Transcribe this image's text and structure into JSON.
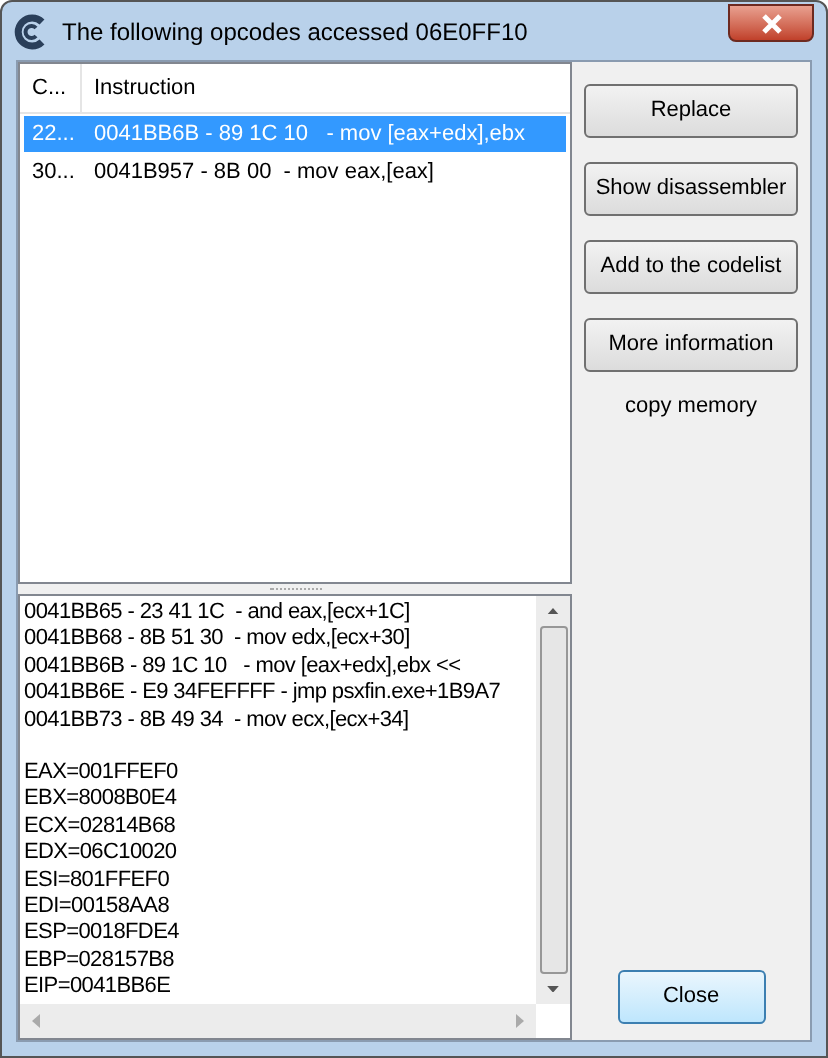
{
  "window": {
    "title": "The following opcodes accessed 06E0FF10"
  },
  "list": {
    "columns": [
      "C...",
      "Instruction"
    ],
    "rows": [
      {
        "count": "22...",
        "instruction": "0041BB6B - 89 1C 10   - mov [eax+edx],ebx",
        "selected": true
      },
      {
        "count": "30...",
        "instruction": "0041B957 - 8B 00  - mov eax,[eax]",
        "selected": false
      }
    ]
  },
  "buttons": [
    "Replace",
    "Show disassembler",
    "Add to the codelist",
    "More information"
  ],
  "copy_memory": "copy memory",
  "details": {
    "disassembly": [
      "0041BB65 - 23 41 1C  - and eax,[ecx+1C]",
      "0041BB68 - 8B 51 30  - mov edx,[ecx+30]",
      "0041BB6B - 89 1C 10   - mov [eax+edx],ebx <<",
      "0041BB6E - E9 34FEFFFF - jmp psxfin.exe+1B9A7",
      "0041BB73 - 8B 49 34  - mov ecx,[ecx+34]"
    ],
    "registers": [
      "EAX=001FFEF0",
      "EBX=8008B0E4",
      "ECX=02814B68",
      "EDX=06C10020",
      "ESI=801FFEF0",
      "EDI=00158AA8",
      "ESP=0018FDE4",
      "EBP=028157B8",
      "EIP=0041BB6E"
    ]
  },
  "close_button": "Close"
}
